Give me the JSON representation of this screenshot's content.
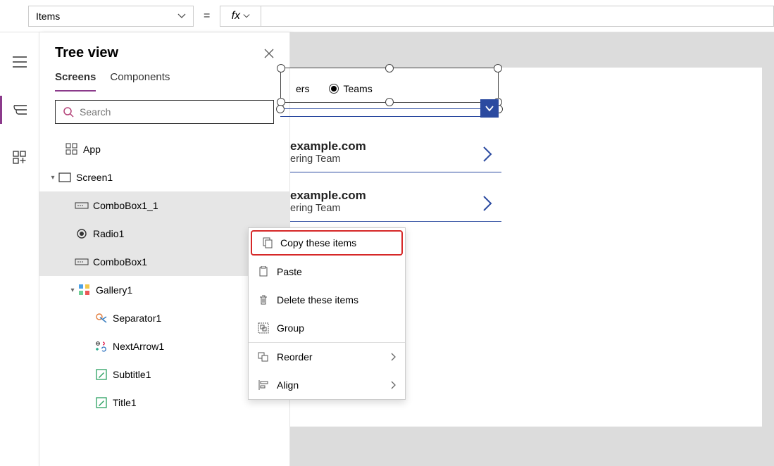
{
  "formula": {
    "property": "Items",
    "fx_label": "fx"
  },
  "panel": {
    "title": "Tree view",
    "tabs": {
      "screens": "Screens",
      "components": "Components"
    },
    "search_placeholder": "Search"
  },
  "tree": {
    "app": "App",
    "screen1": "Screen1",
    "combobox1_1": "ComboBox1_1",
    "radio1": "Radio1",
    "combobox1": "ComboBox1",
    "gallery1": "Gallery1",
    "separator1": "Separator1",
    "nextarrow1": "NextArrow1",
    "subtitle1": "Subtitle1",
    "title1": "Title1"
  },
  "canvas": {
    "radios": {
      "users": "ers",
      "teams": "Teams"
    },
    "items": [
      {
        "title": "example.com",
        "sub": "ering Team"
      },
      {
        "title": "example.com",
        "sub": "ering Team"
      }
    ]
  },
  "context_menu": {
    "copy": "Copy these items",
    "paste": "Paste",
    "delete": "Delete these items",
    "group": "Group",
    "reorder": "Reorder",
    "align": "Align"
  }
}
